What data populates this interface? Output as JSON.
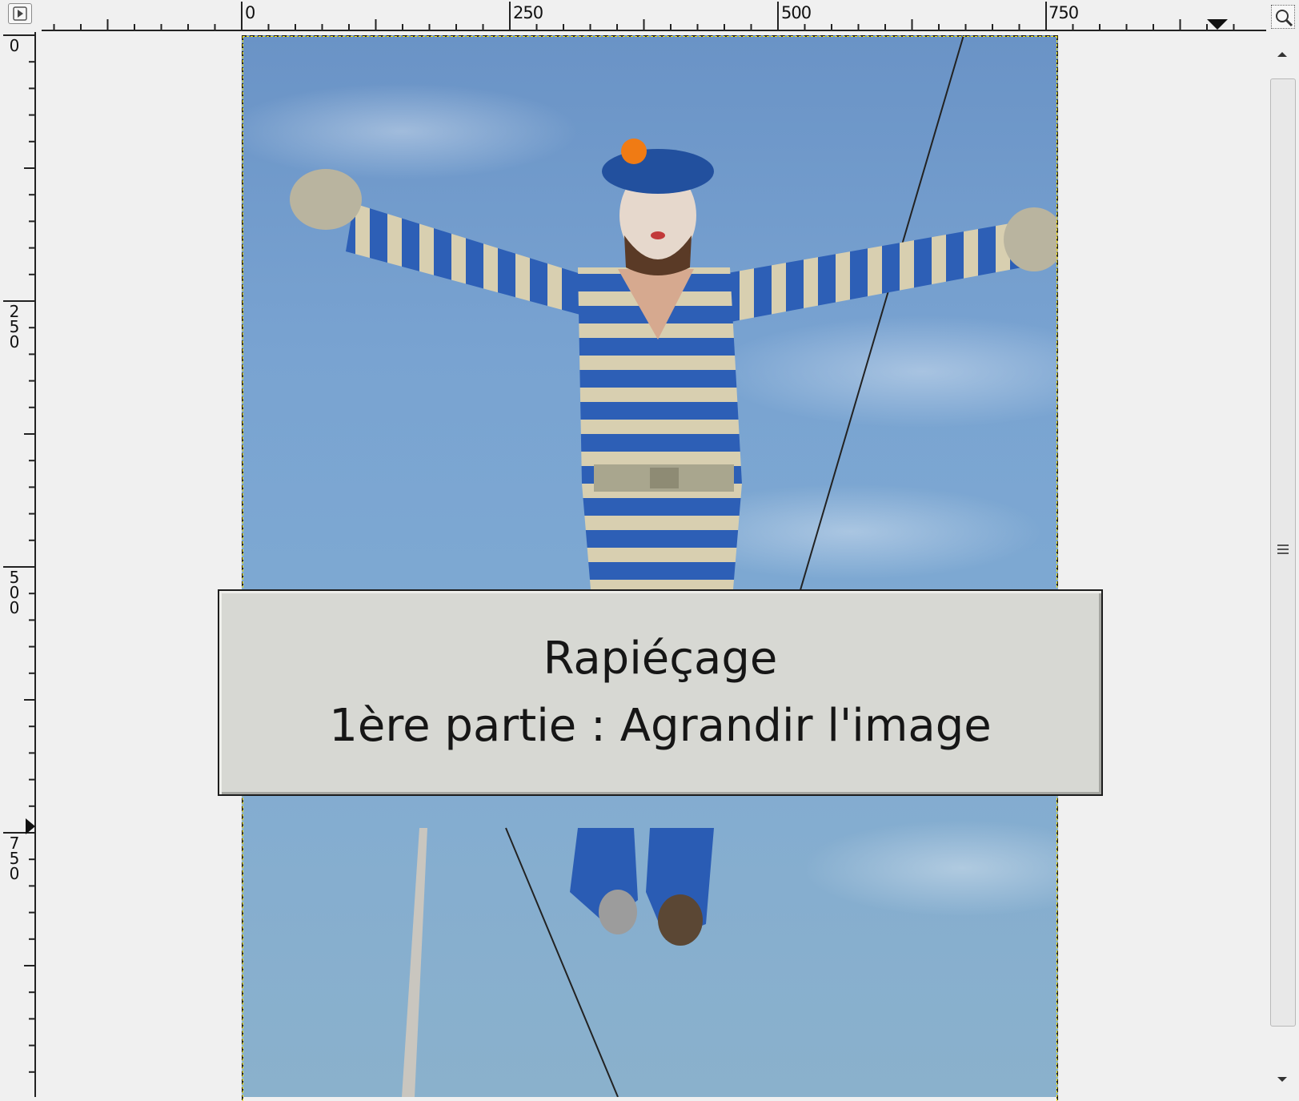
{
  "window": {
    "corner_button_icon": "menu-arrow-icon",
    "navigate_button_icon": "navigate-zoom-icon"
  },
  "rulers": {
    "horizontal_labels": [
      "0",
      "250",
      "500",
      "750"
    ],
    "vertical_labels": [
      "0",
      "250",
      "500",
      "750"
    ]
  },
  "canvas": {
    "image_description_icon": "photo-canvas"
  },
  "caption": {
    "line1": "Rapiéçage",
    "line2": "1ère partie : Agrandir l'image"
  },
  "scrollbar": {
    "up_icon": "scroll-up-arrow-icon",
    "down_icon": "scroll-down-arrow-icon",
    "grip_icon": "scroll-grip-icon"
  },
  "colors": {
    "selection_border": "#ffe600",
    "caption_bg": "#d7d8d3",
    "sky": "#79a3d1"
  }
}
